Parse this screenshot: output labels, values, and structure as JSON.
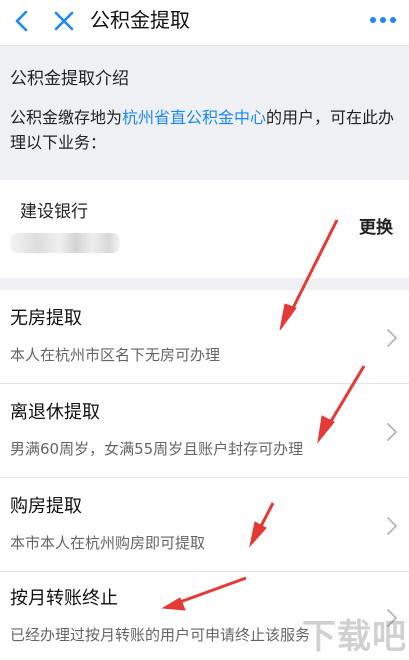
{
  "header": {
    "title": "公积金提取",
    "back_icon": "chevron-left-icon",
    "close_icon": "close-icon",
    "more_icon": "more-dots-icon",
    "accent_color": "#1e88f0"
  },
  "intro": {
    "title": "公积金提取介绍",
    "text_before": "公积金缴存地为",
    "link": "杭州省直公积金中心",
    "text_after": "的用户，可在此办理以下业务："
  },
  "bank": {
    "name": "建设银行",
    "change_label": "更换"
  },
  "items": [
    {
      "title": "无房提取",
      "desc": "本人在杭州市区名下无房可办理"
    },
    {
      "title": "离退休提取",
      "desc": "男满60周岁，女满55周岁且账户封存可办理"
    },
    {
      "title": "购房提取",
      "desc": "本市本人在杭州购房即可提取"
    },
    {
      "title": "按月转账终止",
      "desc": "已经办理过按月转账的用户可申请终止该服务"
    }
  ],
  "annotation_color": "#e53935",
  "watermark": "下载吧"
}
